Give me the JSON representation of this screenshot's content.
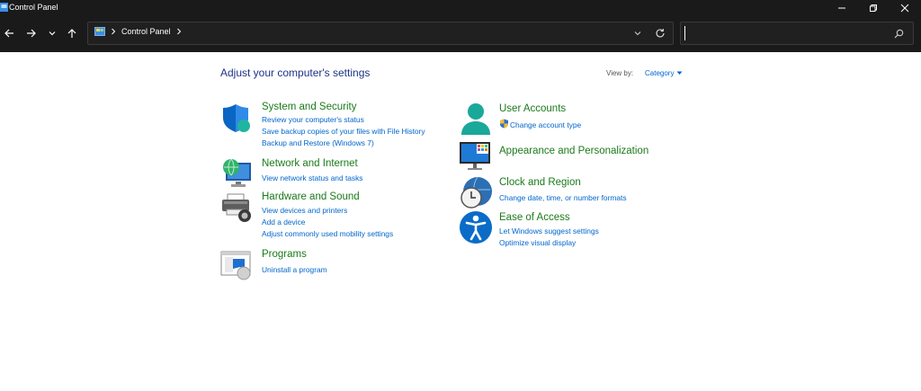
{
  "window": {
    "title": "Control Panel"
  },
  "nav": {
    "breadcrumb": [
      "Control Panel"
    ],
    "search_placeholder": ""
  },
  "main": {
    "heading": "Adjust your computer's settings",
    "view_by_label": "View by:",
    "view_by_value": "Category"
  },
  "categories": [
    {
      "title": "System and Security",
      "links": [
        "Review your computer's status",
        "Save backup copies of your files with File History",
        "Backup and Restore (Windows 7)"
      ]
    },
    {
      "title": "Network and Internet",
      "links": [
        "View network status and tasks"
      ]
    },
    {
      "title": "Hardware and Sound",
      "links": [
        "View devices and printers",
        "Add a device",
        "Adjust commonly used mobility settings"
      ]
    },
    {
      "title": "Programs",
      "links": [
        "Uninstall a program"
      ]
    },
    {
      "title": "User Accounts",
      "links": [
        "Change account type"
      ]
    },
    {
      "title": "Appearance and Personalization",
      "links": []
    },
    {
      "title": "Clock and Region",
      "links": [
        "Change date, time, or number formats"
      ]
    },
    {
      "title": "Ease of Access",
      "links": [
        "Let Windows suggest settings",
        "Optimize visual display"
      ]
    }
  ],
  "colors": {
    "link": "#0066cc",
    "category_title": "#1b7a1b",
    "heading": "#1e3287",
    "chrome": "#1a1a1a"
  }
}
